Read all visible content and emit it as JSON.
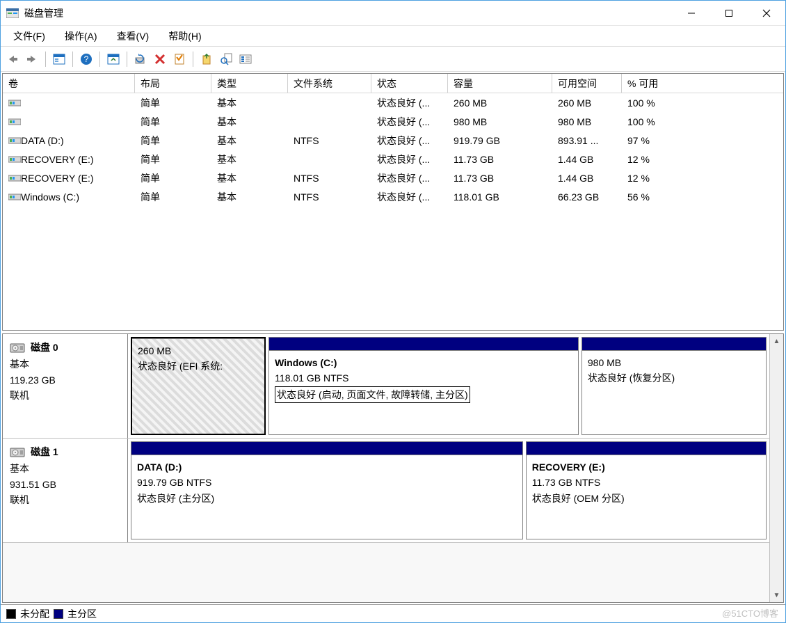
{
  "window": {
    "title": "磁盘管理",
    "watermark": "@51CTO博客"
  },
  "menu": {
    "file": "文件(F)",
    "action": "操作(A)",
    "view": "查看(V)",
    "help": "帮助(H)"
  },
  "columns": {
    "volume": "卷",
    "layout": "布局",
    "type": "类型",
    "fs": "文件系统",
    "status": "状态",
    "capacity": "容量",
    "free": "可用空间",
    "pct": "% 可用"
  },
  "volumes": [
    {
      "name": "",
      "layout": "简单",
      "type": "基本",
      "fs": "",
      "status": "状态良好 (...",
      "capacity": "260 MB",
      "free": "260 MB",
      "pct": "100 %"
    },
    {
      "name": "",
      "layout": "简单",
      "type": "基本",
      "fs": "",
      "status": "状态良好 (...",
      "capacity": "980 MB",
      "free": "980 MB",
      "pct": "100 %"
    },
    {
      "name": "DATA (D:)",
      "layout": "简单",
      "type": "基本",
      "fs": "NTFS",
      "status": "状态良好 (...",
      "capacity": "919.79 GB",
      "free": "893.91 ...",
      "pct": "97 %"
    },
    {
      "name": "RECOVERY (E:)",
      "layout": "简单",
      "type": "基本",
      "fs": "",
      "status": "状态良好 (...",
      "capacity": "11.73 GB",
      "free": "1.44 GB",
      "pct": "12 %"
    },
    {
      "name": "RECOVERY (E:)",
      "layout": "简单",
      "type": "基本",
      "fs": "NTFS",
      "status": "状态良好 (...",
      "capacity": "11.73 GB",
      "free": "1.44 GB",
      "pct": "12 %"
    },
    {
      "name": "Windows (C:)",
      "layout": "简单",
      "type": "基本",
      "fs": "NTFS",
      "status": "状态良好 (...",
      "capacity": "118.01 GB",
      "free": "66.23 GB",
      "pct": "56 %"
    }
  ],
  "disks": [
    {
      "label": "磁盘 0",
      "kind": "基本",
      "size": "119.23 GB",
      "state": "联机",
      "partitions": [
        {
          "title": "",
          "sub": "260 MB",
          "status": "状态良好 (EFI 系统:",
          "flex": 18,
          "hatched": true,
          "selected": false
        },
        {
          "title": "Windows  (C:)",
          "sub": "118.01 GB NTFS",
          "status": "状态良好 (启动, 页面文件, 故障转储, 主分区)",
          "flex": 42,
          "hatched": false,
          "selected": true
        },
        {
          "title": "",
          "sub": "980 MB",
          "status": "状态良好 (恢复分区)",
          "flex": 25,
          "hatched": false,
          "selected": false
        }
      ]
    },
    {
      "label": "磁盘 1",
      "kind": "基本",
      "size": "931.51 GB",
      "state": "联机",
      "partitions": [
        {
          "title": "DATA  (D:)",
          "sub": "919.79 GB NTFS",
          "status": "状态良好 (主分区)",
          "flex": 62,
          "hatched": false,
          "selected": false
        },
        {
          "title": "RECOVERY  (E:)",
          "sub": "11.73 GB NTFS",
          "status": "状态良好 (OEM 分区)",
          "flex": 38,
          "hatched": false,
          "selected": false
        }
      ]
    }
  ],
  "legend": {
    "unalloc": "未分配",
    "primary": "主分区"
  }
}
